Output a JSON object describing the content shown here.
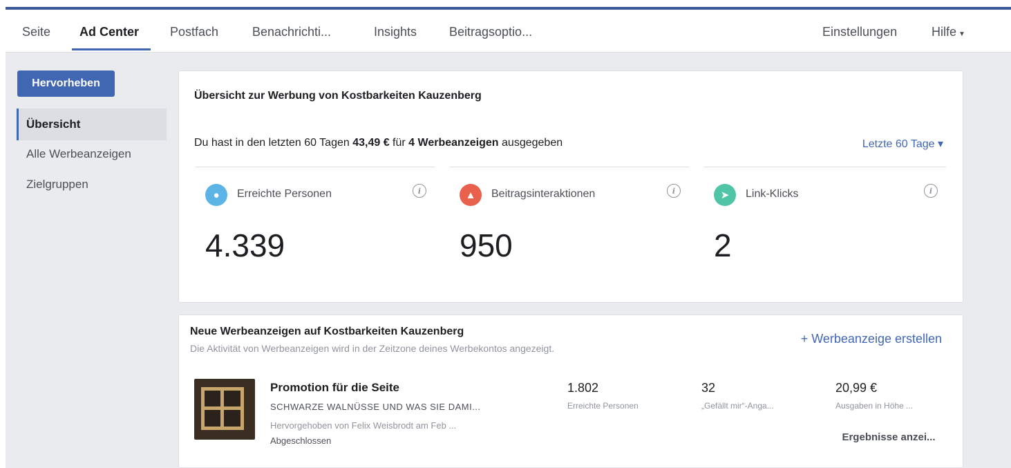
{
  "tabs": [
    {
      "label": "Seite"
    },
    {
      "label": "Ad Center"
    },
    {
      "label": "Postfach"
    },
    {
      "label": "Benachrichti..."
    },
    {
      "label": "Insights"
    },
    {
      "label": "Beitragsoptio..."
    }
  ],
  "right_tabs": {
    "settings": "Einstellungen",
    "help": "Hilfe"
  },
  "sidebar": {
    "boost_button": "Hervorheben",
    "items": [
      {
        "label": "Übersicht"
      },
      {
        "label": "Alle Werbeanzeigen"
      },
      {
        "label": "Zielgruppen"
      }
    ]
  },
  "overview": {
    "title": "Übersicht zur Werbung von Kostbarkeiten Kauzenberg",
    "summary_prefix": "Du hast in den letzten 60 Tagen ",
    "summary_amount": "43,49 €",
    "summary_mid": " für ",
    "summary_count": "4 Werbeanzeigen",
    "summary_suffix": " ausgegeben",
    "range": "Letzte 60 Tage",
    "metrics": [
      {
        "label": "Erreichte Personen",
        "value": "4.339",
        "icon": "people-icon",
        "color": "#5bb3e6"
      },
      {
        "label": "Beitragsinteraktionen",
        "value": "950",
        "icon": "thumb-icon",
        "color": "#e9604d"
      },
      {
        "label": "Link-Klicks",
        "value": "2",
        "icon": "cursor-icon",
        "color": "#4fc4a6"
      }
    ]
  },
  "new_ads": {
    "title": "Neue Werbeanzeigen auf Kostbarkeiten Kauzenberg",
    "subtitle": "Die Aktivität von Werbeanzeigen wird in der Zeitzone deines Werbekontos angezeigt.",
    "create_label": "+ Werbeanzeige erstellen",
    "ad": {
      "title": "Promotion für die Seite",
      "headline": "SCHWARZE WALNÜSSE UND WAS SIE DAMI...",
      "boosted_by": "Hervorgehoben von Felix Weisbrodt am Feb ...",
      "status": "Abgeschlossen",
      "reach_value": "1.802",
      "reach_label": "Erreichte Personen",
      "likes_value": "32",
      "likes_label": "„Gefällt mir“-Anga...",
      "spend_value": "20,99 €",
      "spend_label": "Ausgaben in Höhe ...",
      "results_button": "Ergebnisse anzei..."
    }
  }
}
